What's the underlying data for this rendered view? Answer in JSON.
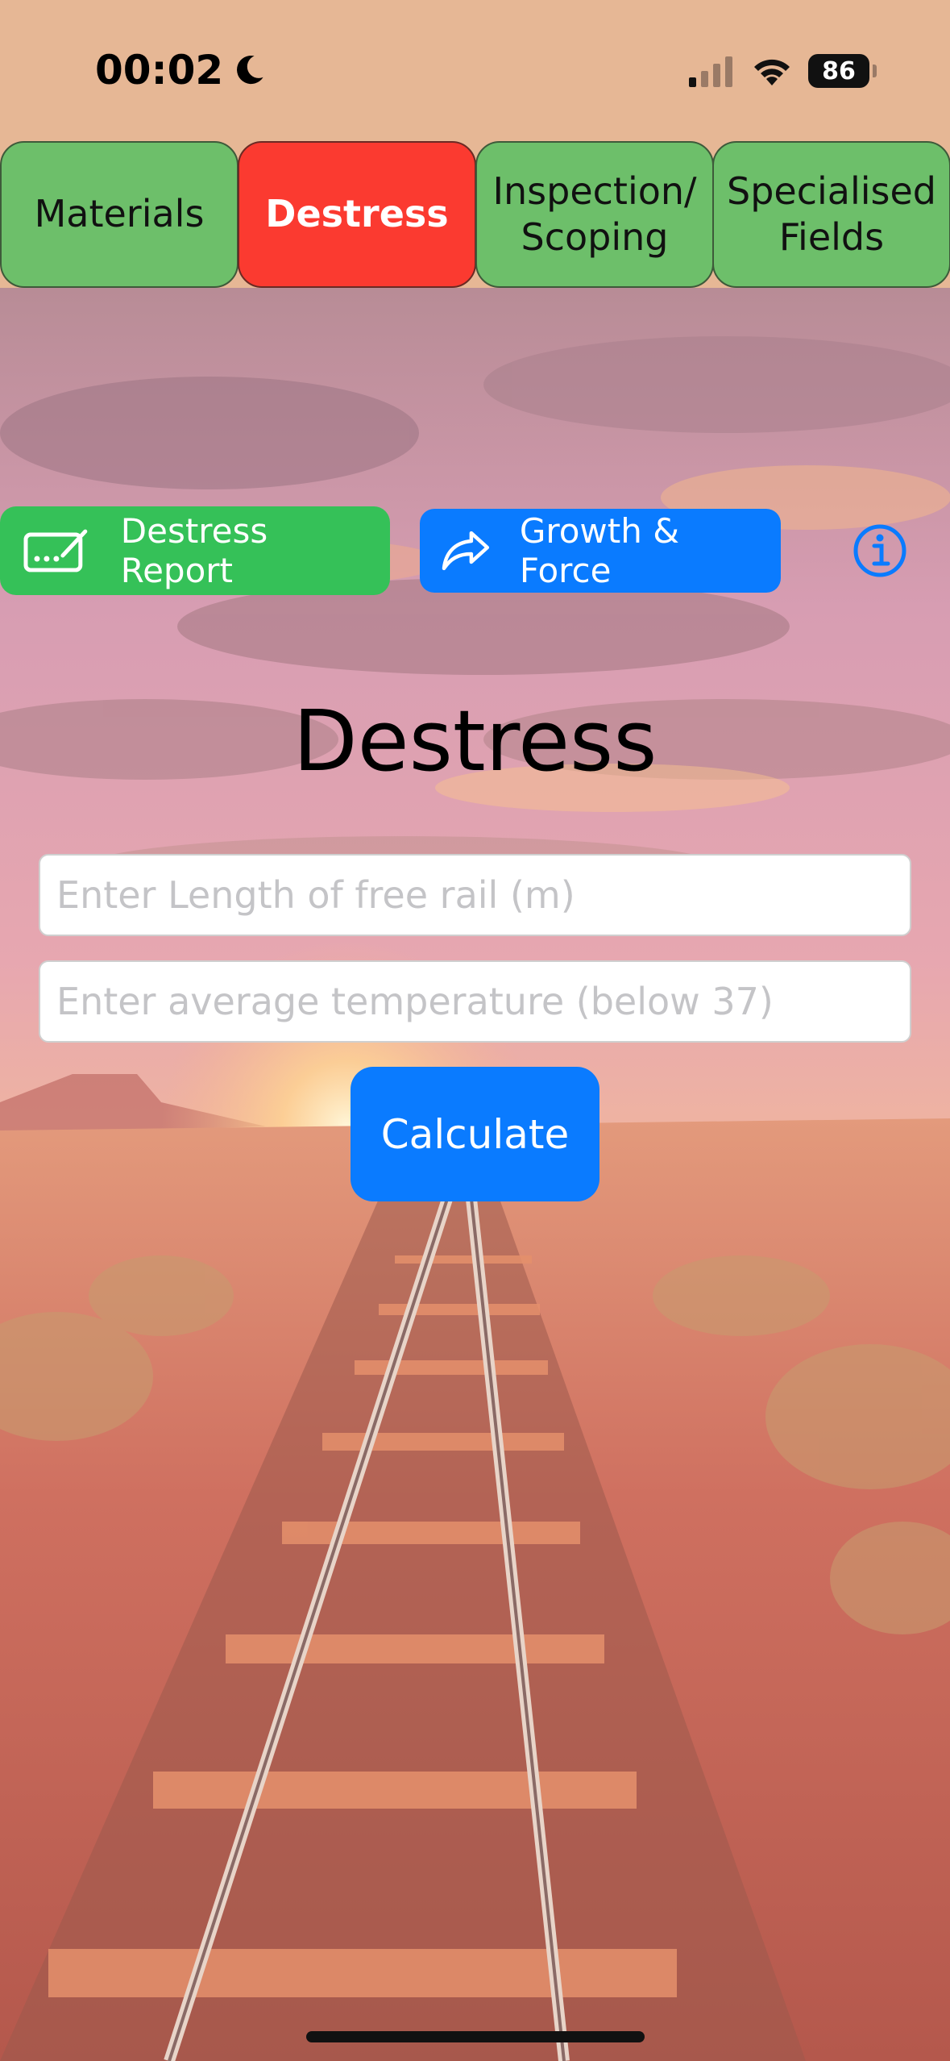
{
  "status_bar": {
    "time": "00:02",
    "battery_level": "86",
    "icons": [
      "moon-icon",
      "signal-icon",
      "wifi-icon",
      "battery-icon"
    ]
  },
  "tabs": [
    {
      "label": "Materials",
      "active": false
    },
    {
      "label": "Destress",
      "active": true
    },
    {
      "label": "Inspection/\nScoping",
      "active": false
    },
    {
      "label": "Specialised\nFields",
      "active": false
    }
  ],
  "actions": {
    "report_label": "Destress Report",
    "report_icon": "signature-icon",
    "growth_label": "Growth & Force",
    "growth_icon": "share-arrow-icon",
    "info_icon": "info-icon"
  },
  "main": {
    "title": "Destress",
    "length_placeholder": "Enter Length of free rail (m)",
    "temperature_placeholder": "Enter average temperature (below 37)",
    "calculate_label": "Calculate"
  },
  "colors": {
    "tab_green": "#6dbf6a",
    "tab_active_red": "#fb3a30",
    "report_green": "#35c158",
    "accent_blue": "#0a7bff",
    "status_bar_bg": "#e6b795"
  },
  "background": "sunset-railway-track-photo"
}
